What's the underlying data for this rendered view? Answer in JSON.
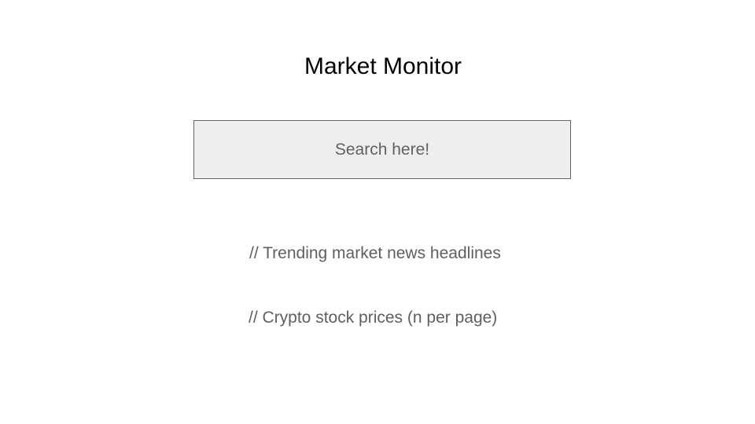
{
  "header": {
    "title": "Market Monitor"
  },
  "search": {
    "placeholder": "Search here!"
  },
  "sections": {
    "news_note": "// Trending market news headlines",
    "prices_note": "// Crypto stock prices (n per page)"
  },
  "colors": {
    "background": "#ffffff",
    "search_fill": "#eeeeee",
    "search_border": "#666666",
    "note_text": "#5f5f5f",
    "title_text": "#000000"
  }
}
